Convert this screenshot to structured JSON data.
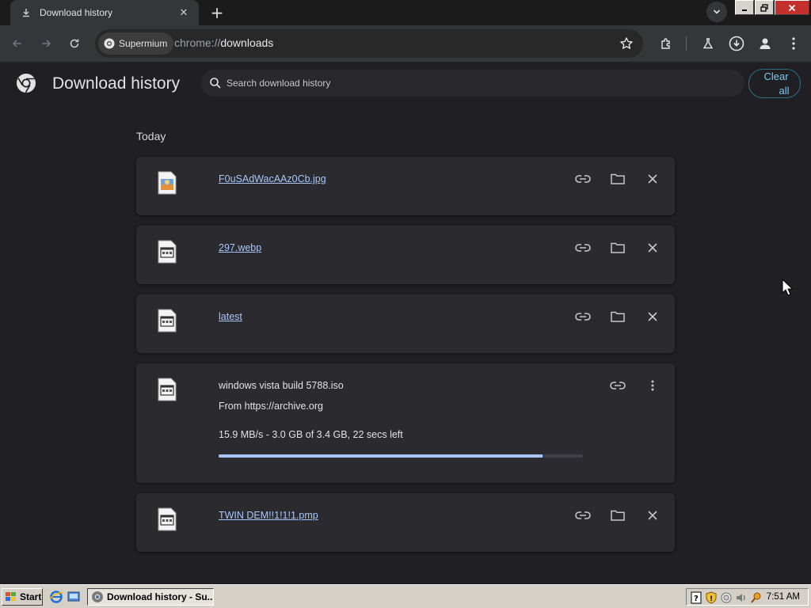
{
  "tab": {
    "title": "Download history"
  },
  "toolbar": {
    "chip_label": "Supermium",
    "url_scheme": "chrome://",
    "url_path": "downloads"
  },
  "header": {
    "title": "Download history",
    "search_placeholder": "Search download history",
    "clear_all_line1": "Clear",
    "clear_all_line2": "all"
  },
  "section": {
    "label": "Today"
  },
  "downloads": [
    {
      "name": "F0uSAdWacAAz0Cb.jpg"
    },
    {
      "name": "297.webp"
    },
    {
      "name": "latest"
    },
    {
      "name": "windows vista build 5788.iso",
      "from": "From https://archive.org",
      "status": "15.9 MB/s - 3.0 GB of 3.4 GB, 22 secs left",
      "progress": 0.89
    },
    {
      "name": "TWIN DEM!!1!1!1.pmp"
    }
  ],
  "taskbar": {
    "start_label": "Start",
    "task_title": "Download history - Su...",
    "clock": "7:51 AM"
  },
  "colors": {
    "accent": "#a8c7fa",
    "card": "#2a2a2f",
    "background": "#1f1f24"
  }
}
